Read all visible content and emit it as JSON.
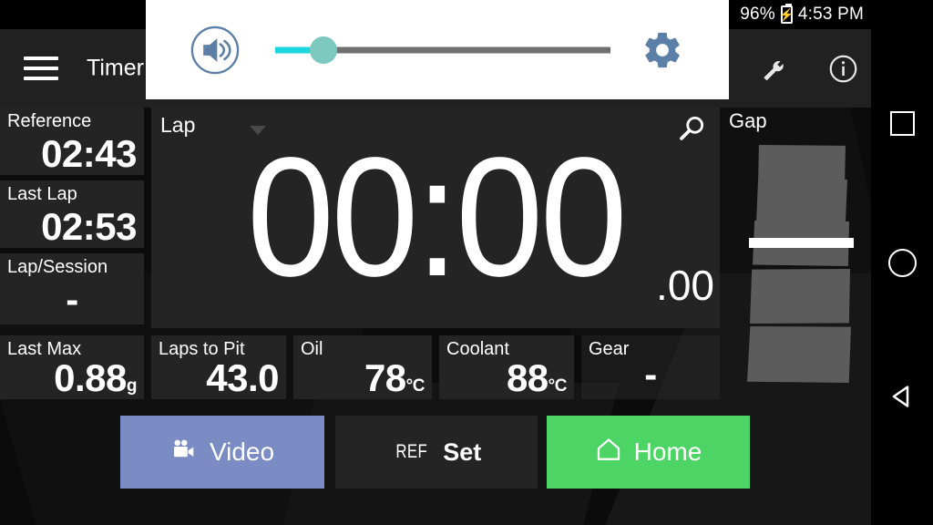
{
  "statusbar": {
    "battery_percent": "96%",
    "battery_icon": "battery-charging-icon",
    "charging_glyph": "⚡",
    "time": "4:53 PM"
  },
  "appbar": {
    "menu_icon": "hamburger-menu-icon",
    "title": "Timer",
    "wrench_icon": "wrench-icon",
    "info_icon": "info-circle-icon"
  },
  "volume_popup": {
    "speaker_icon": "speaker-volume-icon",
    "gear_icon": "gear-icon",
    "slider": {
      "value_percent": 14.5,
      "fill_color": "#1ad6dd",
      "thumb_color": "#7dc8bf",
      "track_color": "#707070"
    },
    "background": "#ffffff"
  },
  "timer_panel": {
    "mode_label": "Lap",
    "caret_icon": "chevron-down-icon",
    "search_icon": "magnifier-icon",
    "value": "00:00",
    "fraction": ".00"
  },
  "tiles": [
    {
      "id": "reference",
      "label": "Reference",
      "value": "02:43",
      "unit": ""
    },
    {
      "id": "lastlap",
      "label": "Last Lap",
      "value": "02:53",
      "unit": ""
    },
    {
      "id": "lapsession",
      "label": "Lap/Session",
      "value": "-",
      "unit": ""
    },
    {
      "id": "lastmax",
      "label": "Last Max",
      "value": "0.88",
      "unit": "g"
    },
    {
      "id": "lapstopit",
      "label": "Laps to Pit",
      "value": "43.0",
      "unit": ""
    },
    {
      "id": "oil",
      "label": "Oil",
      "value": "78",
      "unit": "°C"
    },
    {
      "id": "coolant",
      "label": "Coolant",
      "value": "88",
      "unit": "°C"
    },
    {
      "id": "gear",
      "label": "Gear",
      "value": "-",
      "unit": ""
    }
  ],
  "gap_gauge": {
    "label": "Gap",
    "segment_color": "#5c5c5c",
    "marker_color": "#ffffff"
  },
  "buttons": {
    "video": {
      "label": "Video",
      "icon": "video-camera-icon",
      "color": "#7b8bc4"
    },
    "refset": {
      "prefix": "REF",
      "label": "Set",
      "color": "#242424"
    },
    "home": {
      "label": "Home",
      "icon": "home-icon",
      "color": "#4cd464"
    }
  },
  "navbar": {
    "recents_icon": "square-recents-icon",
    "home_icon": "circle-home-icon",
    "back_icon": "triangle-back-icon"
  }
}
